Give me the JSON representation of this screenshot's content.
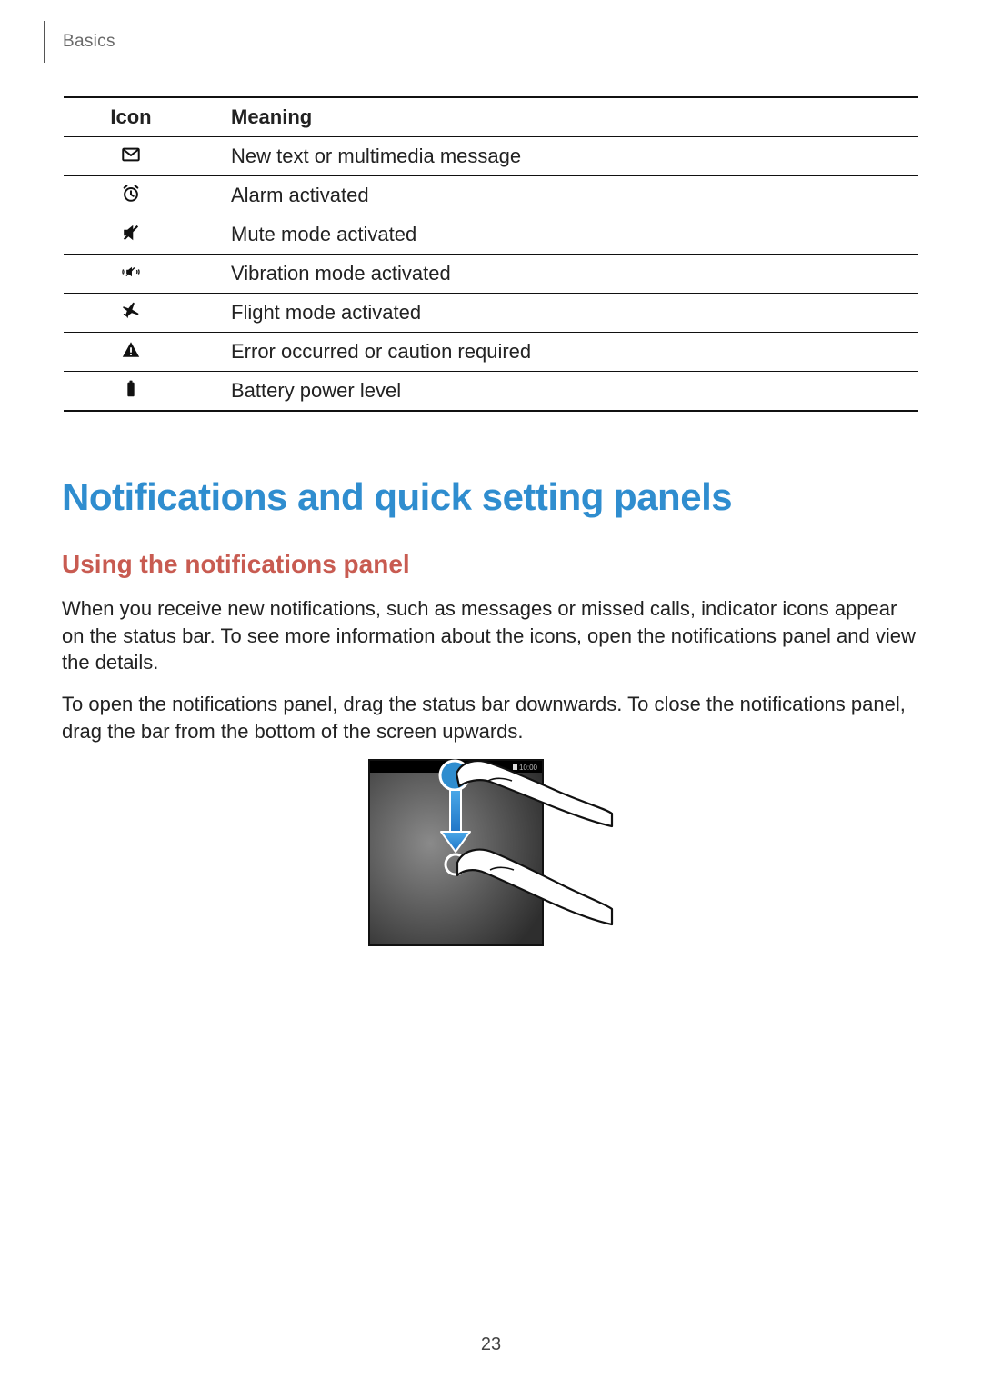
{
  "running_head": "Basics",
  "table": {
    "head": {
      "icon": "Icon",
      "meaning": "Meaning"
    },
    "rows": [
      {
        "icon_name": "message-icon",
        "meaning": "New text or multimedia message"
      },
      {
        "icon_name": "alarm-icon",
        "meaning": "Alarm activated"
      },
      {
        "icon_name": "mute-icon",
        "meaning": "Mute mode activated"
      },
      {
        "icon_name": "vibration-icon",
        "meaning": "Vibration mode activated"
      },
      {
        "icon_name": "airplane-icon",
        "meaning": "Flight mode activated"
      },
      {
        "icon_name": "warning-icon",
        "meaning": "Error occurred or caution required"
      },
      {
        "icon_name": "battery-icon",
        "meaning": "Battery power level"
      }
    ]
  },
  "heading_main": "Notifications and quick setting panels",
  "heading_sub": "Using the notifications panel",
  "para1": "When you receive new notifications, such as messages or missed calls, indicator icons appear on the status bar. To see more information about the icons, open the notifications panel and view the details.",
  "para2": "To open the notifications panel, drag the status bar downwards. To close the notifications panel, drag the bar from the bottom of the screen upwards.",
  "illustration_status_time": "10:00",
  "page_number": "23"
}
